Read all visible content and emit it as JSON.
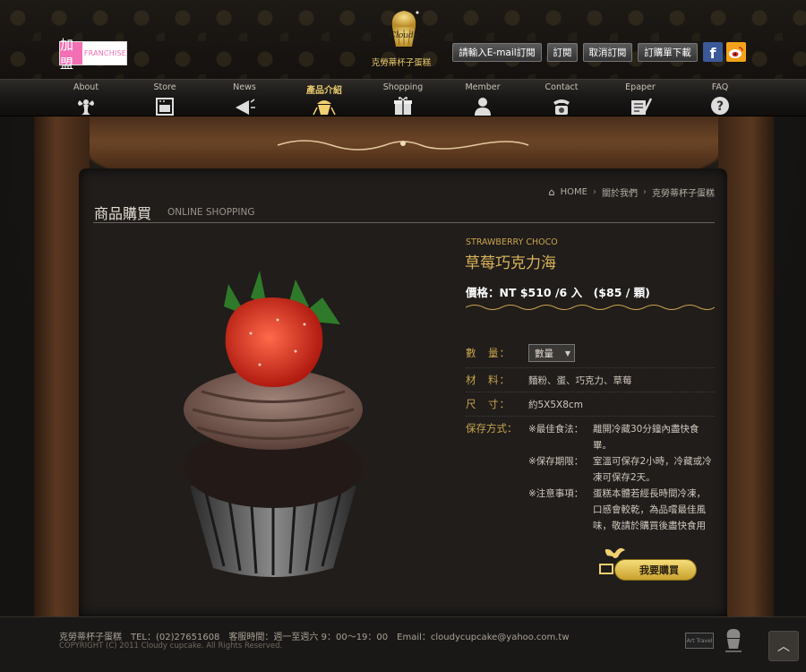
{
  "header": {
    "franchise_zh": "加盟",
    "franchise_en": "FRANCHISE",
    "logo_text": "Cloudy",
    "logo_sub": "克勞蒂杯子蛋糕",
    "email_placeholder": "請輸入E-mail訂閱",
    "subscribe": "訂閱",
    "unsubscribe": "取消訂閱",
    "order_download": "訂購單下載",
    "facebook": "f"
  },
  "nav": [
    {
      "label": "About",
      "icon": "angel-icon"
    },
    {
      "label": "Store",
      "icon": "oven-icon"
    },
    {
      "label": "News",
      "icon": "megaphone-icon"
    },
    {
      "label": "產品介紹",
      "icon": "cupcake-icon",
      "active": true
    },
    {
      "label": "Shopping",
      "icon": "gift-icon"
    },
    {
      "label": "Member",
      "icon": "user-icon"
    },
    {
      "label": "Contact",
      "icon": "phone-icon"
    },
    {
      "label": "Epaper",
      "icon": "newsletter-icon"
    },
    {
      "label": "FAQ",
      "icon": "question-icon"
    }
  ],
  "breadcrumb": {
    "home": "HOME",
    "items": [
      "關於我們",
      "克勞蒂杯子蛋糕"
    ],
    "sep": "›"
  },
  "section": {
    "title_zh": "商品購買",
    "title_en": "ONLINE SHOPPING"
  },
  "product": {
    "name_en": "STRAWBERRY CHOCO",
    "name_zh": "草莓巧克力海",
    "price": "價格：NT $510 /6 入　($85 / 顆)",
    "qty_label": "數　量：",
    "qty_value": "數量",
    "material_label": "材　料：",
    "material": "麵粉、蛋、巧克力、草莓",
    "size_label": "尺　寸：",
    "size": "約5X5X8cm",
    "storage_label": "保存方式：",
    "storage": [
      {
        "label": "※最佳食法：",
        "text": "離開冷藏30分鐘內盡快食畢。"
      },
      {
        "label": "※保存期限：",
        "text": "室溫可保存2小時，冷藏或冷凍可保存2天。"
      },
      {
        "label": "※注意事項：",
        "text": "蛋糕本體若經長時間冷凍，口感會較乾，為品嚐最佳風味，敬請於購買後盡快食用"
      }
    ],
    "buy": "我要購買"
  },
  "footer": {
    "line1": "克勞蒂杯子蛋糕　TEL：(02)27651608　客服時間：週一至週六 9：00～19：00　Email：cloudycupcake@yahoo.com.tw",
    "line2": "COPYRIGHT (C) 2011 Cloudy cupcake. All Rights Reserved.",
    "badge": "Art Travel"
  },
  "colors": {
    "accent_gold": "#d9b45a",
    "background": "#201d1b",
    "franchise_pink": "#f36fb3"
  }
}
